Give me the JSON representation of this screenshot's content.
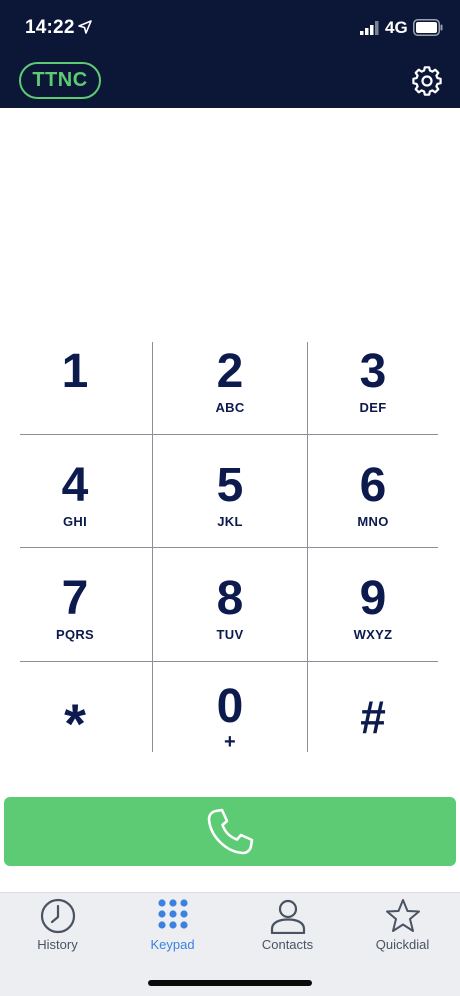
{
  "status_bar": {
    "time": "14:22",
    "network": "4G"
  },
  "header": {
    "logo_text": "TTNC"
  },
  "keypad": {
    "keys": [
      {
        "digit": "1",
        "letters": ""
      },
      {
        "digit": "2",
        "letters": "ABC"
      },
      {
        "digit": "3",
        "letters": "DEF"
      },
      {
        "digit": "4",
        "letters": "GHI"
      },
      {
        "digit": "5",
        "letters": "JKL"
      },
      {
        "digit": "6",
        "letters": "MNO"
      },
      {
        "digit": "7",
        "letters": "PQRS"
      },
      {
        "digit": "8",
        "letters": "TUV"
      },
      {
        "digit": "9",
        "letters": "WXYZ"
      },
      {
        "digit": "*",
        "letters": ""
      },
      {
        "digit": "0",
        "letters": "+"
      },
      {
        "digit": "#",
        "letters": ""
      }
    ]
  },
  "call_button": {
    "icon": "phone-icon",
    "color": "#5dcb74"
  },
  "tabs": [
    {
      "label": "History",
      "icon": "clock-icon"
    },
    {
      "label": "Keypad",
      "icon": "keypad-grid-icon",
      "active": true
    },
    {
      "label": "Contacts",
      "icon": "person-icon"
    },
    {
      "label": "Quickdial",
      "icon": "star-icon"
    }
  ],
  "colors": {
    "header_bg": "#0c1637",
    "accent_green": "#5dcb74",
    "key_text": "#0c1a4d",
    "tab_active": "#3b82e0"
  }
}
